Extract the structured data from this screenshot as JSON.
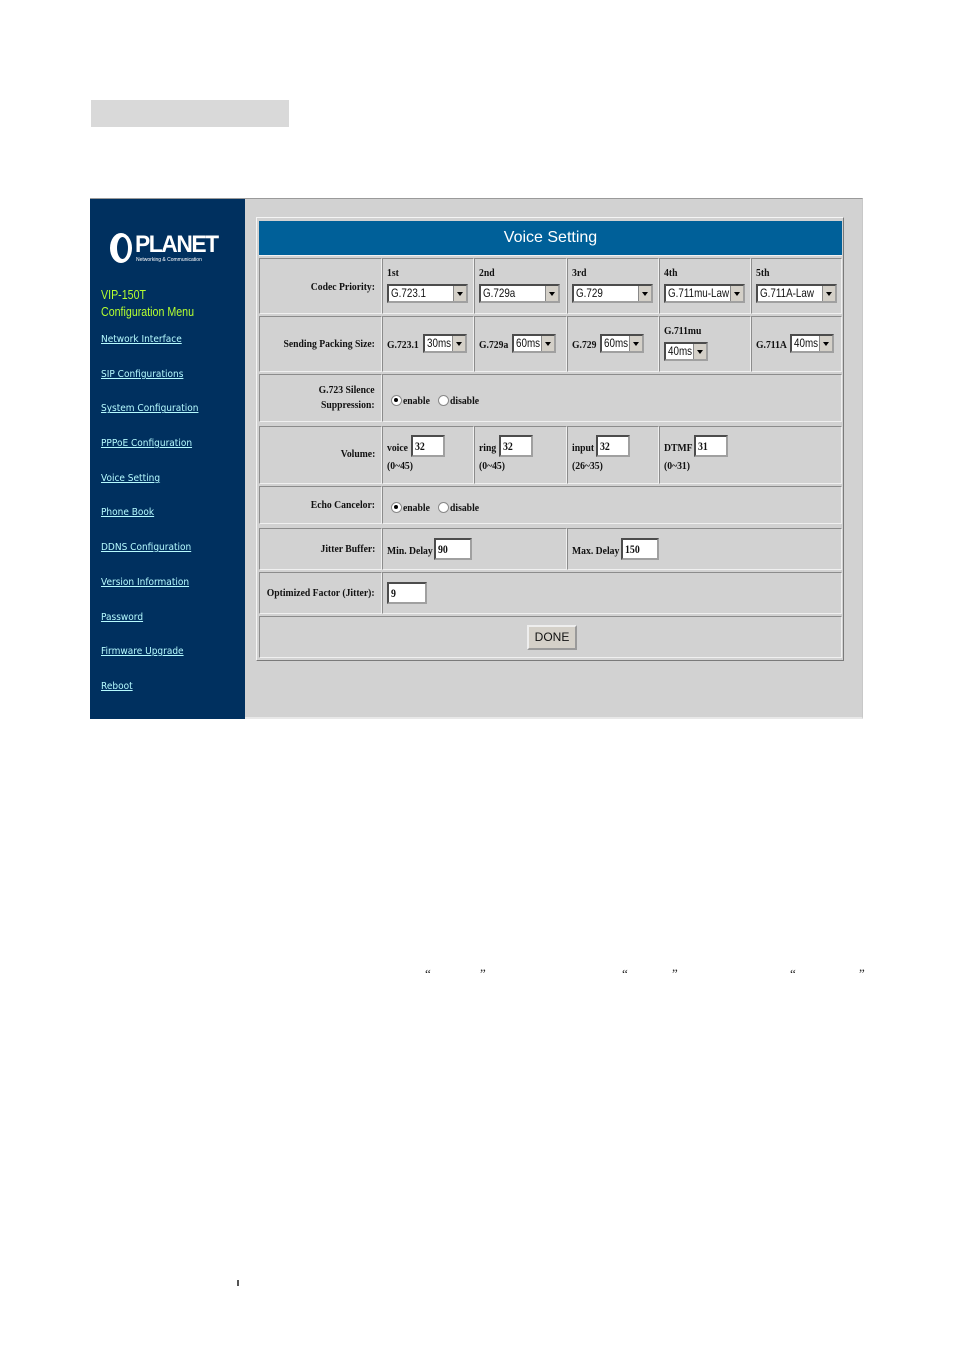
{
  "sidebar": {
    "logo": {
      "name": "PLANET",
      "tagline": "Networking & Communication"
    },
    "model": "VIP-150T",
    "menu_title": "Configuration Menu",
    "items": [
      {
        "label": "Network Interface"
      },
      {
        "label": "SIP Configurations"
      },
      {
        "label": "System Configuration"
      },
      {
        "label": "PPPoE Configuration"
      },
      {
        "label": "Voice Setting"
      },
      {
        "label": "Phone Book"
      },
      {
        "label": "DDNS Configuration"
      },
      {
        "label": "Version Information"
      },
      {
        "label": "Password"
      },
      {
        "label": "Firmware Upgrade"
      },
      {
        "label": "Reboot"
      }
    ]
  },
  "form": {
    "title": "Voice Setting",
    "codec_priority": {
      "label": "Codec Priority:",
      "slots": [
        {
          "heading": "1st",
          "value": "G.723.1"
        },
        {
          "heading": "2nd",
          "value": "G.729a"
        },
        {
          "heading": "3rd",
          "value": "G.729"
        },
        {
          "heading": "4th",
          "value": "G.711mu-Law"
        },
        {
          "heading": "5th",
          "value": "G.711A-Law"
        }
      ]
    },
    "packing_size": {
      "label": "Sending Packing Size:",
      "items": [
        {
          "codec": "G.723.1",
          "value": "30ms"
        },
        {
          "codec": "G.729a",
          "value": "60ms"
        },
        {
          "codec": "G.729",
          "value": "60ms"
        },
        {
          "codec": "G.711mu",
          "value": "40ms"
        },
        {
          "codec": "G.711A",
          "value": "40ms"
        }
      ]
    },
    "silence_suppression": {
      "label_line1": "G.723 Silence",
      "label_line2": "Suppression:",
      "options": [
        "enable",
        "disable"
      ],
      "selected": "enable"
    },
    "volume": {
      "label": "Volume:",
      "items": [
        {
          "name": "voice",
          "value": "32",
          "range": "(0~45)"
        },
        {
          "name": "ring",
          "value": "32",
          "range": "(0~45)"
        },
        {
          "name": "input",
          "value": "32",
          "range": "(26~35)"
        },
        {
          "name": "DTMF",
          "value": "31",
          "range": "(0~31)"
        }
      ]
    },
    "echo_canceler": {
      "label": "Echo Cancelor:",
      "options": [
        "enable",
        "disable"
      ],
      "selected": "enable"
    },
    "jitter_buffer": {
      "label": "Jitter Buffer:",
      "min_label": "Min. Delay",
      "min_value": "90",
      "max_label": "Max. Delay",
      "max_value": "150"
    },
    "optimized_factor": {
      "label": "Optimized Factor (Jitter):",
      "value": "9"
    },
    "done_label": "DONE"
  },
  "page_text": {
    "quotes": [
      "“",
      "”",
      "“",
      "”",
      "“",
      "”"
    ]
  }
}
